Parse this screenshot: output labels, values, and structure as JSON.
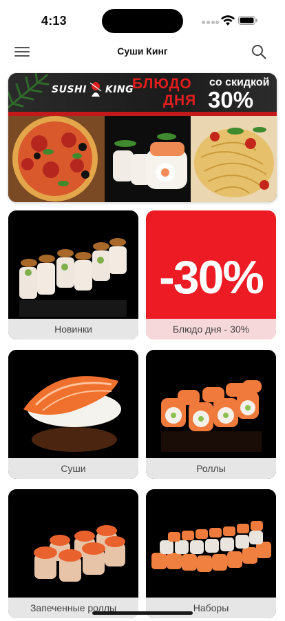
{
  "status": {
    "time": "4:13"
  },
  "nav": {
    "title": "Суши Кинг",
    "menu_icon": "hamburger-menu-icon",
    "search_icon": "search-icon"
  },
  "banner": {
    "logo_text": "SUSHI",
    "logo_text2": "KING",
    "line1": "БЛЮДО",
    "line2": "ДНЯ",
    "discount_caption": "со скидкой",
    "discount_value": "30%",
    "accent_color": "#e31d1d"
  },
  "categories": [
    {
      "label": "Новинки"
    },
    {
      "label": "Блюдо дня - 30%",
      "badge": "-30%"
    },
    {
      "label": "Суши"
    },
    {
      "label": "Роллы"
    },
    {
      "label": "Запеченные роллы"
    },
    {
      "label": "Наборы"
    }
  ]
}
